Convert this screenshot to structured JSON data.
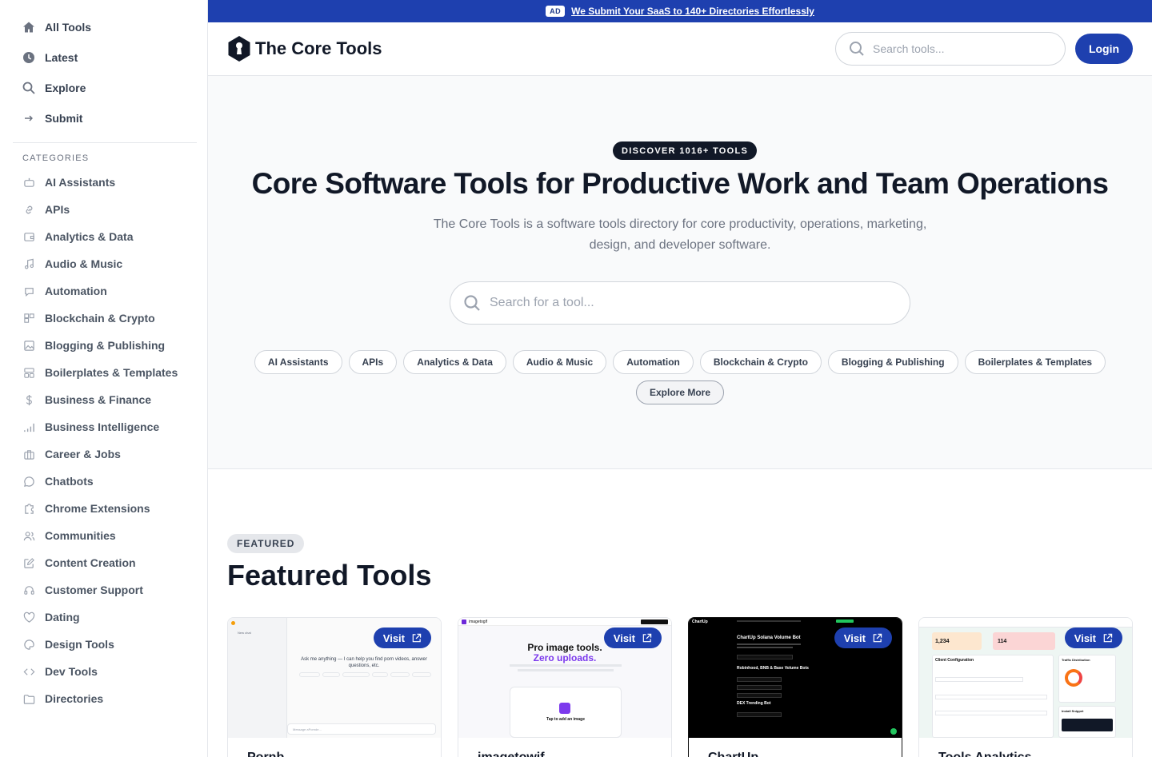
{
  "sidebar": {
    "nav": [
      {
        "label": "All Tools",
        "icon": "home-icon"
      },
      {
        "label": "Latest",
        "icon": "clock-icon"
      },
      {
        "label": "Explore",
        "icon": "search-icon"
      },
      {
        "label": "Submit",
        "icon": "arrow-right-icon"
      }
    ],
    "categories_heading": "CATEGORIES",
    "categories": [
      {
        "label": "AI Assistants",
        "icon": "robot-icon"
      },
      {
        "label": "APIs",
        "icon": "link-icon"
      },
      {
        "label": "Analytics & Data",
        "icon": "wallet-icon"
      },
      {
        "label": "Audio & Music",
        "icon": "music-note-icon"
      },
      {
        "label": "Automation",
        "icon": "bot-icon"
      },
      {
        "label": "Blockchain & Crypto",
        "icon": "blocks-icon"
      },
      {
        "label": "Blogging & Publishing",
        "icon": "image-icon"
      },
      {
        "label": "Boilerplates & Templates",
        "icon": "layout-icon"
      },
      {
        "label": "Business & Finance",
        "icon": "dollar-icon"
      },
      {
        "label": "Business Intelligence",
        "icon": "signal-bars-icon"
      },
      {
        "label": "Career & Jobs",
        "icon": "briefcase-icon"
      },
      {
        "label": "Chatbots",
        "icon": "chat-bubble-icon"
      },
      {
        "label": "Chrome Extensions",
        "icon": "puzzle-icon"
      },
      {
        "label": "Communities",
        "icon": "users-icon"
      },
      {
        "label": "Content Creation",
        "icon": "edit-icon"
      },
      {
        "label": "Customer Support",
        "icon": "headset-icon"
      },
      {
        "label": "Dating",
        "icon": "heart-icon"
      },
      {
        "label": "Design Tools",
        "icon": "palette-icon"
      },
      {
        "label": "Dev Tools",
        "icon": "code-icon"
      },
      {
        "label": "Directories",
        "icon": "folder-icon"
      }
    ]
  },
  "ad": {
    "tag": "AD",
    "text": "We Submit Your SaaS to 140+ Directories Effortlessly"
  },
  "header": {
    "logo_text": "The Core Tools",
    "search_placeholder": "Search tools...",
    "login_label": "Login"
  },
  "hero": {
    "badge": "DISCOVER 1016+ TOOLS",
    "title": "Core Software Tools for Productive Work and Team Operations",
    "subtitle": "The Core Tools is a software tools directory for core productivity, operations, marketing, design, and developer software.",
    "search_placeholder": "Search for a tool...",
    "chips": [
      "AI Assistants",
      "APIs",
      "Analytics & Data",
      "Audio & Music",
      "Automation",
      "Blockchain & Crypto",
      "Blogging & Publishing",
      "Boilerplates & Templates"
    ],
    "more_label": "Explore More"
  },
  "featured": {
    "badge": "FEATURED",
    "title": "Featured Tools",
    "visit_label": "Visit",
    "cards": [
      {
        "name": "Pornb...",
        "shot": {
          "heading": "Ask me anything — I can help you find porn videos, answer questions, etc.",
          "new_chat": "New chat",
          "input": "Message aPornde..."
        }
      },
      {
        "name": "imagetowif...",
        "shot": {
          "brand": "imagetogif",
          "line1": "Pro image tools.",
          "line2": "Zero uploads.",
          "cta": "Tap to add an image"
        }
      },
      {
        "name": "ChartUp",
        "shot": {
          "brand": "ChartUp",
          "line1": "ChartUp Solana Volume Bot",
          "line2": "Robinhood, BNB & Base Volume Bots",
          "line3": "DEX Trending Bot"
        }
      },
      {
        "name": "Tools Analytics",
        "shot": {
          "stat1": "1,234",
          "stat2": "114",
          "panel1": "Client Configuration",
          "panel2": "Traffic Distribution",
          "panel3": "Install Snippet"
        }
      }
    ]
  },
  "colors": {
    "brand": "#1e40af",
    "dark": "#111827",
    "muted": "#6b7280"
  }
}
